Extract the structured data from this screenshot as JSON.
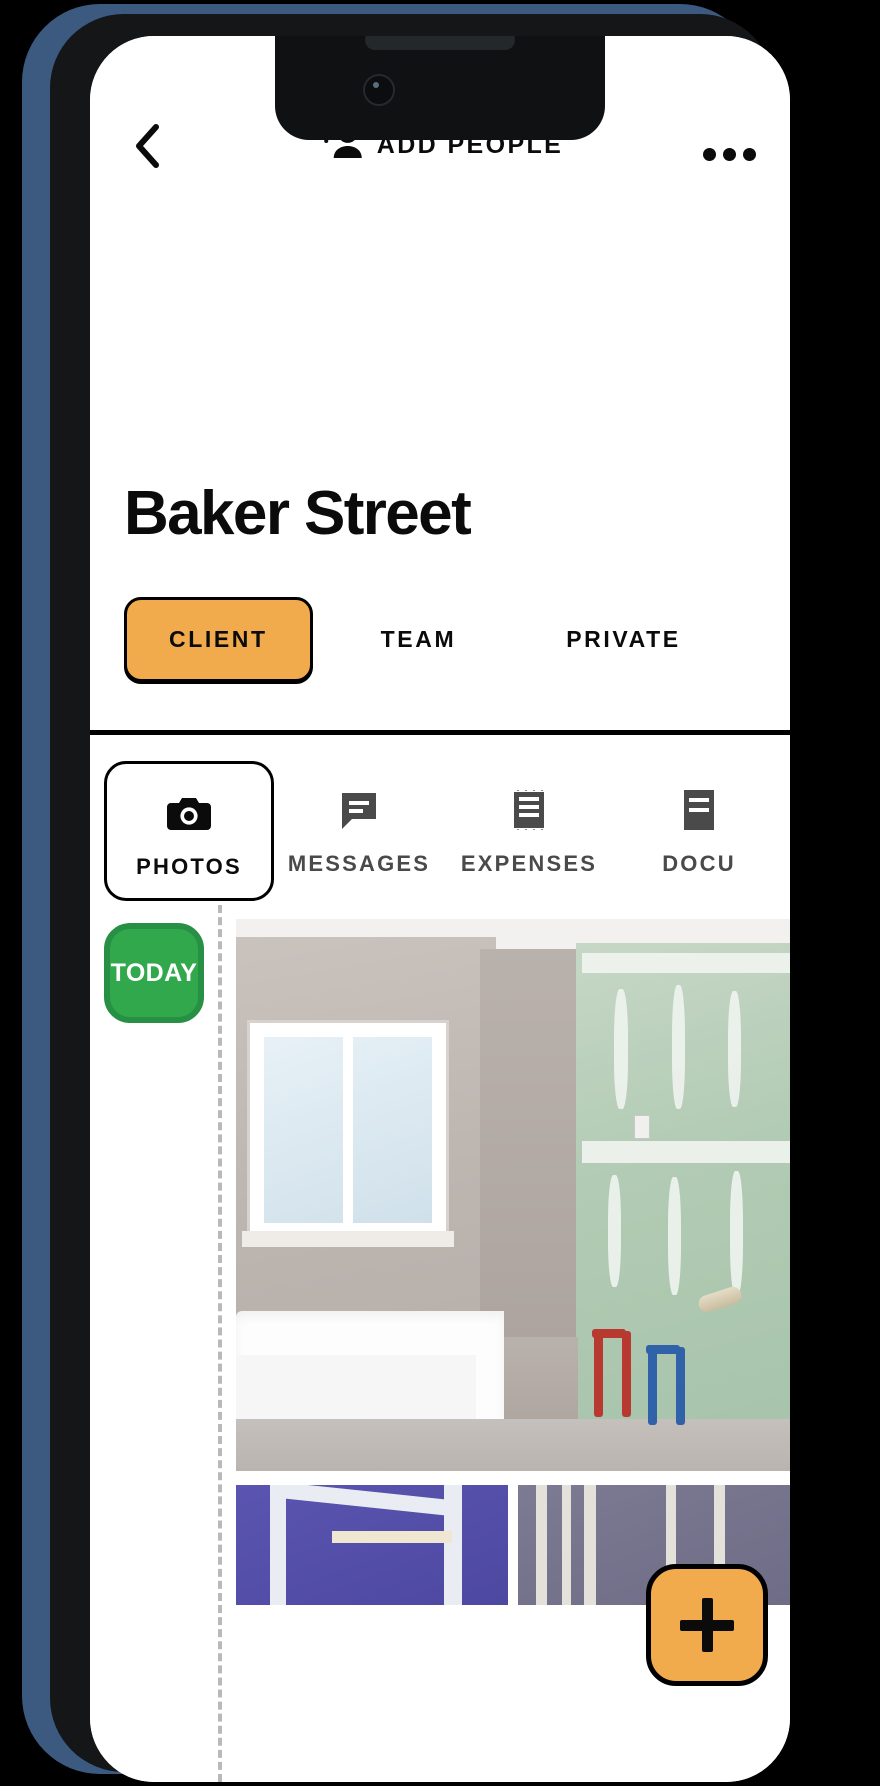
{
  "header": {
    "back_icon": "chevron-left-icon",
    "add_people_icon": "person-add-icon",
    "add_people_label": "ADD PEOPLE",
    "more_icon": "overflow-menu-icon"
  },
  "project": {
    "title": "Baker Street"
  },
  "audience_tabs": [
    {
      "label": "CLIENT",
      "active": true
    },
    {
      "label": "TEAM",
      "active": false
    },
    {
      "label": "PRIVATE",
      "active": false
    }
  ],
  "section_tabs": [
    {
      "label": "PHOTOS",
      "icon": "camera-icon",
      "active": true
    },
    {
      "label": "MESSAGES",
      "icon": "chat-icon",
      "active": false
    },
    {
      "label": "EXPENSES",
      "icon": "receipt-icon",
      "active": false
    },
    {
      "label": "DOCU",
      "icon": "document-icon",
      "active": false
    }
  ],
  "feed": {
    "date_badge": "TODAY",
    "hero_photo_alt": "bathroom renovation with tiled wall, window, bathtub and green drywall",
    "thumbnails": [
      {
        "alt": "purple drywall room corner"
      },
      {
        "alt": "grey drywall wall panels"
      }
    ]
  },
  "fab": {
    "icon": "plus-icon",
    "label": "+"
  },
  "colors": {
    "accent": "#f2ab4c",
    "today_badge": "#31a84c",
    "ink": "#0b0b0b",
    "muted": "#4a4a4a",
    "frame": "#3c5a80"
  }
}
